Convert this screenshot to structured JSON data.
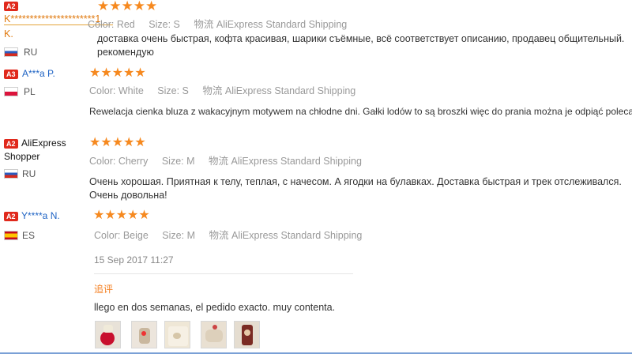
{
  "reviews": [
    {
      "badge": "A2",
      "name_line1": "K**********************1",
      "name_line2": "K.",
      "country": "RU",
      "stars": "★★★★★",
      "color_label": "Color:",
      "color": "Red",
      "size_label": "Size:",
      "size": "S",
      "ship_label": "物流",
      "shipping": "AliExpress Standard Shipping",
      "text": "доставка очень быстрая, кофта красивая, шарики съёмные, всё соответствует описанию, продавец общительный. рекомендую"
    },
    {
      "badge": "A3",
      "name": "A***a P.",
      "country": "PL",
      "stars": "★★★★★",
      "color_label": "Color:",
      "color": "White",
      "size_label": "Size:",
      "size": "S",
      "ship_label": "物流",
      "shipping": "AliExpress Standard Shipping",
      "text": "Rewelacja cienka bluza z wakacyjnym motywem na chłodne dni. Gałki lodów to są broszki więc do prania można je odpiąć polecam"
    },
    {
      "badge": "A2",
      "name_line1": "AliExpress",
      "name_line2": "Shopper",
      "country": "RU",
      "stars": "★★★★★",
      "color_label": "Color:",
      "color": "Cherry",
      "size_label": "Size:",
      "size": "M",
      "ship_label": "物流",
      "shipping": "AliExpress Standard Shipping",
      "text": "Очень хорошая. Приятная к телу, теплая, с начесом. А ягодки на булавках. Доставка быстрая и трек отслеживался. Очень довольна!"
    },
    {
      "badge": "A2",
      "name": "Y****a N.",
      "country": "ES",
      "stars": "★★★★★",
      "color_label": "Color:",
      "color": "Beige",
      "size_label": "Size:",
      "size": "M",
      "ship_label": "物流",
      "shipping": "AliExpress Standard Shipping",
      "date": "15 Sep 2017 11:27",
      "followup_label": "追评",
      "followup_text": "llego en dos semanas, el pedido exacto. muy contenta."
    }
  ],
  "colors": {
    "star": "#f6891f",
    "badge": "#e0291c",
    "link": "#1e63c4",
    "followup": "#f47f20"
  }
}
